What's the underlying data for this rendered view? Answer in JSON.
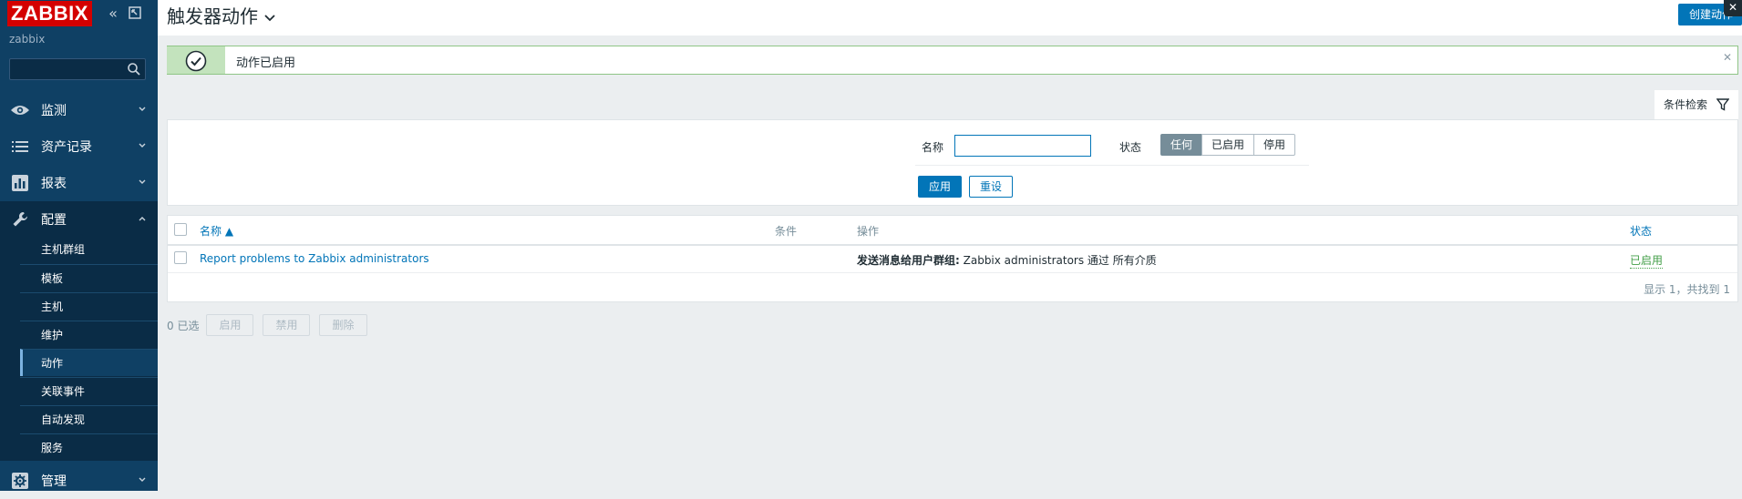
{
  "sidebar": {
    "logo": "ZABBIX",
    "server_name": "zabbix",
    "search_placeholder": "",
    "menu": [
      {
        "label": "监测",
        "icon": "eye-icon"
      },
      {
        "label": "资产记录",
        "icon": "list-icon"
      },
      {
        "label": "报表",
        "icon": "bar-chart-icon"
      },
      {
        "label": "配置",
        "icon": "wrench-icon"
      },
      {
        "label": "管理",
        "icon": "gear-icon"
      }
    ],
    "submenu": [
      {
        "label": "主机群组"
      },
      {
        "label": "模板"
      },
      {
        "label": "主机"
      },
      {
        "label": "维护"
      },
      {
        "label": "动作"
      },
      {
        "label": "关联事件"
      },
      {
        "label": "自动发现"
      },
      {
        "label": "服务"
      }
    ]
  },
  "header": {
    "title": "触发器动作",
    "create_button": "创建动作",
    "corner_close": "✕"
  },
  "message": {
    "text": "动作已启用",
    "close": "✕"
  },
  "filter": {
    "tab_label": "条件检索",
    "name_label": "名称",
    "name_value": "",
    "status_label": "状态",
    "status_options": [
      "任何",
      "已启用",
      "停用"
    ],
    "status_selected": "任何",
    "apply": "应用",
    "reset": "重设"
  },
  "table": {
    "headers": {
      "name": "名称 ▲",
      "conditions": "条件",
      "operations": "操作",
      "status": "状态"
    },
    "rows": [
      {
        "name": "Report problems to Zabbix administrators",
        "conditions": "",
        "operations_bold": "发送消息给用户群组:",
        "operations_rest": " Zabbix administrators 通过 所有介质",
        "status": "已启用"
      }
    ],
    "summary": "显示 1，共找到 1"
  },
  "bottom": {
    "selected": "0 已选",
    "enable": "启用",
    "disable": "禁用",
    "delete": "删除"
  },
  "colors": {
    "sidebar_bg": "#0f4064",
    "accent": "#0275b8",
    "logo_red": "#d40000",
    "enabled_green": "#429e47"
  }
}
